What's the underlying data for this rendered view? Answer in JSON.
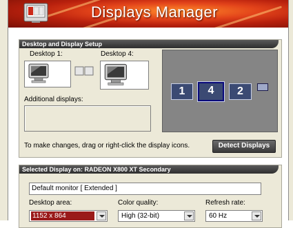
{
  "window": {
    "title": "Displays Manager"
  },
  "setup_panel": {
    "header": "Desktop and Display Setup",
    "desktop1_label": "Desktop 1:",
    "desktop4_label": "Desktop 4:",
    "additional_label": "Additional displays:",
    "hint": "To make changes, drag or right-click the display icons.",
    "detect_button": "Detect Displays",
    "arrangement": [
      {
        "label": "1"
      },
      {
        "label": "4"
      },
      {
        "label": "2"
      }
    ]
  },
  "selected_panel": {
    "header": "Selected Display on: RADEON X800 XT Secondary",
    "monitor_name": "Default monitor [ Extended ]",
    "desktop_area_label": "Desktop area:",
    "desktop_area_value": "1152 x 864",
    "color_quality_label": "Color quality:",
    "color_quality_value": "High (32-bit)",
    "refresh_rate_label": "Refresh rate:",
    "refresh_rate_value": "60 Hz"
  },
  "colors": {
    "banner": "#c72d12",
    "panel_bg": "#ece9d8",
    "header_bg": "#3a3a3a",
    "tile_bg": "#3b4a73",
    "selected_value_bg": "#9a1a1a"
  }
}
